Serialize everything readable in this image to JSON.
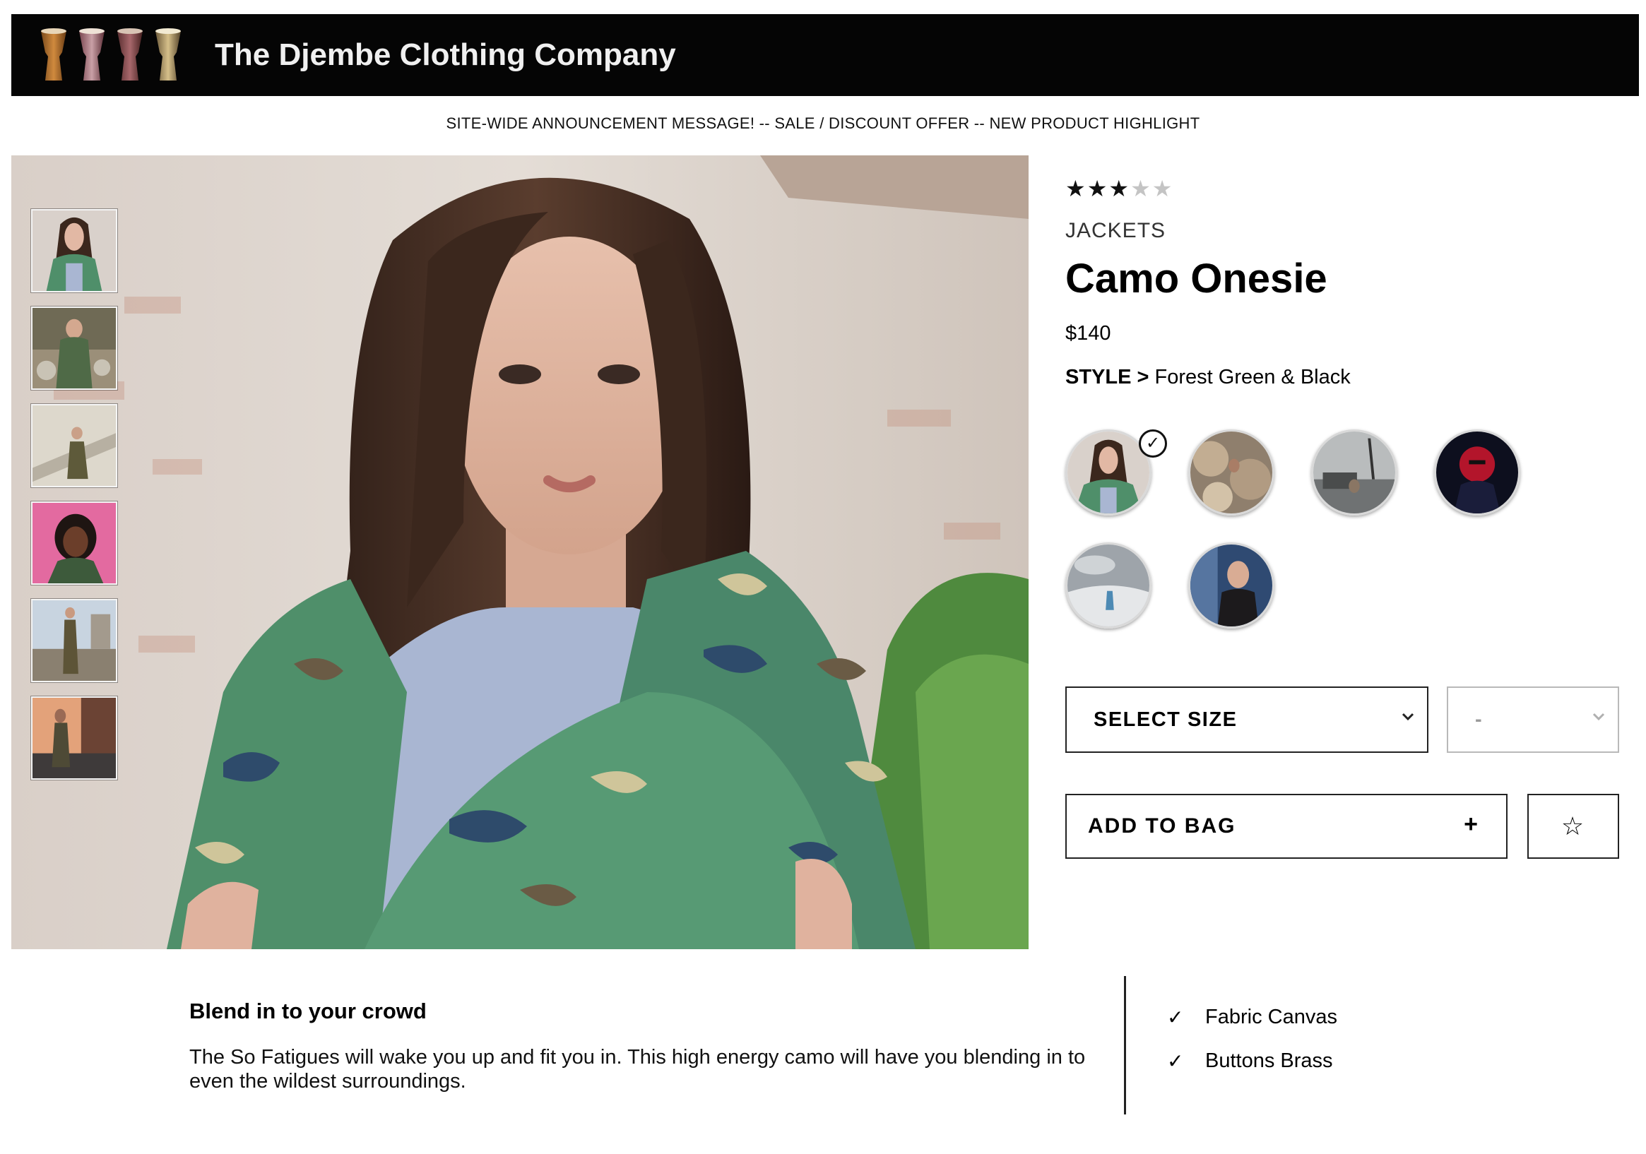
{
  "header": {
    "brand": "The Djembe Clothing Company",
    "logo_icon": "djembe-drums-icon"
  },
  "announcement": "SITE-WIDE ANNOUNCEMENT MESSAGE! -- SALE / DISCOUNT OFFER -- NEW PRODUCT HIGHLIGHT",
  "gallery": {
    "thumbnails": [
      {
        "name": "camo-jacket-woman"
      },
      {
        "name": "camo-outfit-rocks"
      },
      {
        "name": "camo-stairs"
      },
      {
        "name": "pink-background-portrait"
      },
      {
        "name": "railway-camo-suit"
      },
      {
        "name": "sunset-balcony"
      }
    ]
  },
  "product": {
    "rating": 3,
    "rating_max": 5,
    "category": "JACKETS",
    "title": "Camo Onesie",
    "price": "$140",
    "style_label": "STYLE >",
    "style_value": "Forest Green & Black",
    "swatches": [
      {
        "name": "forest-green-black",
        "selected": true
      },
      {
        "name": "desert-rocks",
        "selected": false
      },
      {
        "name": "harbor-grey",
        "selected": false
      },
      {
        "name": "red-neon",
        "selected": false
      },
      {
        "name": "snow-grey",
        "selected": false
      },
      {
        "name": "urban-blue",
        "selected": false
      }
    ]
  },
  "controls": {
    "size_select": "SELECT SIZE",
    "qty_select": "-",
    "add_to_bag": "ADD TO BAG",
    "add_icon": "+",
    "favorite_icon": "☆"
  },
  "description": {
    "heading": "Blend in to your crowd",
    "body": "The So Fatigues will wake you up and fit you in. This high energy camo will have you blending in to even the wildest surroundings.",
    "features": [
      "Fabric Canvas",
      "Buttons Brass"
    ]
  },
  "colors": {
    "header_bg": "#050505",
    "accent": "#000000"
  }
}
